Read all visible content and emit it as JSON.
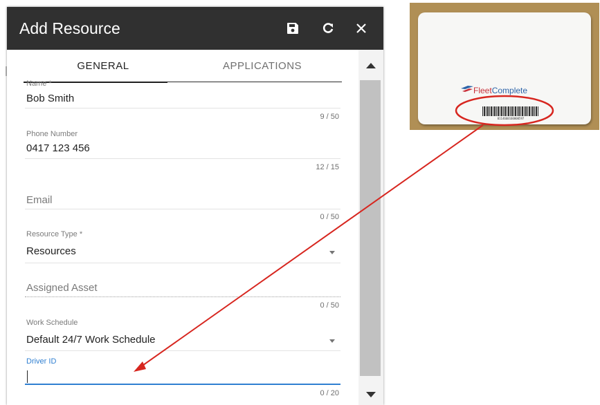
{
  "dialog": {
    "title": "Add Resource",
    "actions": {
      "save_icon": "save-icon",
      "refresh_icon": "refresh-icon",
      "close_icon": "close-icon"
    },
    "tabs": [
      {
        "label": "GENERAL",
        "active": true
      },
      {
        "label": "APPLICATIONS",
        "active": false
      }
    ]
  },
  "form": {
    "name": {
      "label": "Name *",
      "value": "Bob Smith",
      "counter": "9 / 50"
    },
    "phone": {
      "label": "Phone Number",
      "value": "0417 123 456",
      "counter": "12 / 15"
    },
    "email": {
      "placeholder": "Email",
      "counter": "0 / 50"
    },
    "resource_type": {
      "label": "Resource Type *",
      "value": "Resources"
    },
    "assigned_asset": {
      "placeholder": "Assigned Asset",
      "counter": "0 / 50"
    },
    "work_schedule": {
      "label": "Work Schedule",
      "value": "Default 24/7 Work Schedule"
    },
    "driver_id": {
      "label": "Driver ID",
      "value": "",
      "counter": "0 / 20"
    }
  },
  "card": {
    "logo_part1": "Fleet",
    "logo_part2": "Complete",
    "barcode_number": "0114660160000597"
  },
  "colors": {
    "titlebar": "#303030",
    "focus": "#2f7fd1",
    "annotation": "#d7261f",
    "brand_red": "#c8303a",
    "brand_blue": "#2c63a8"
  }
}
